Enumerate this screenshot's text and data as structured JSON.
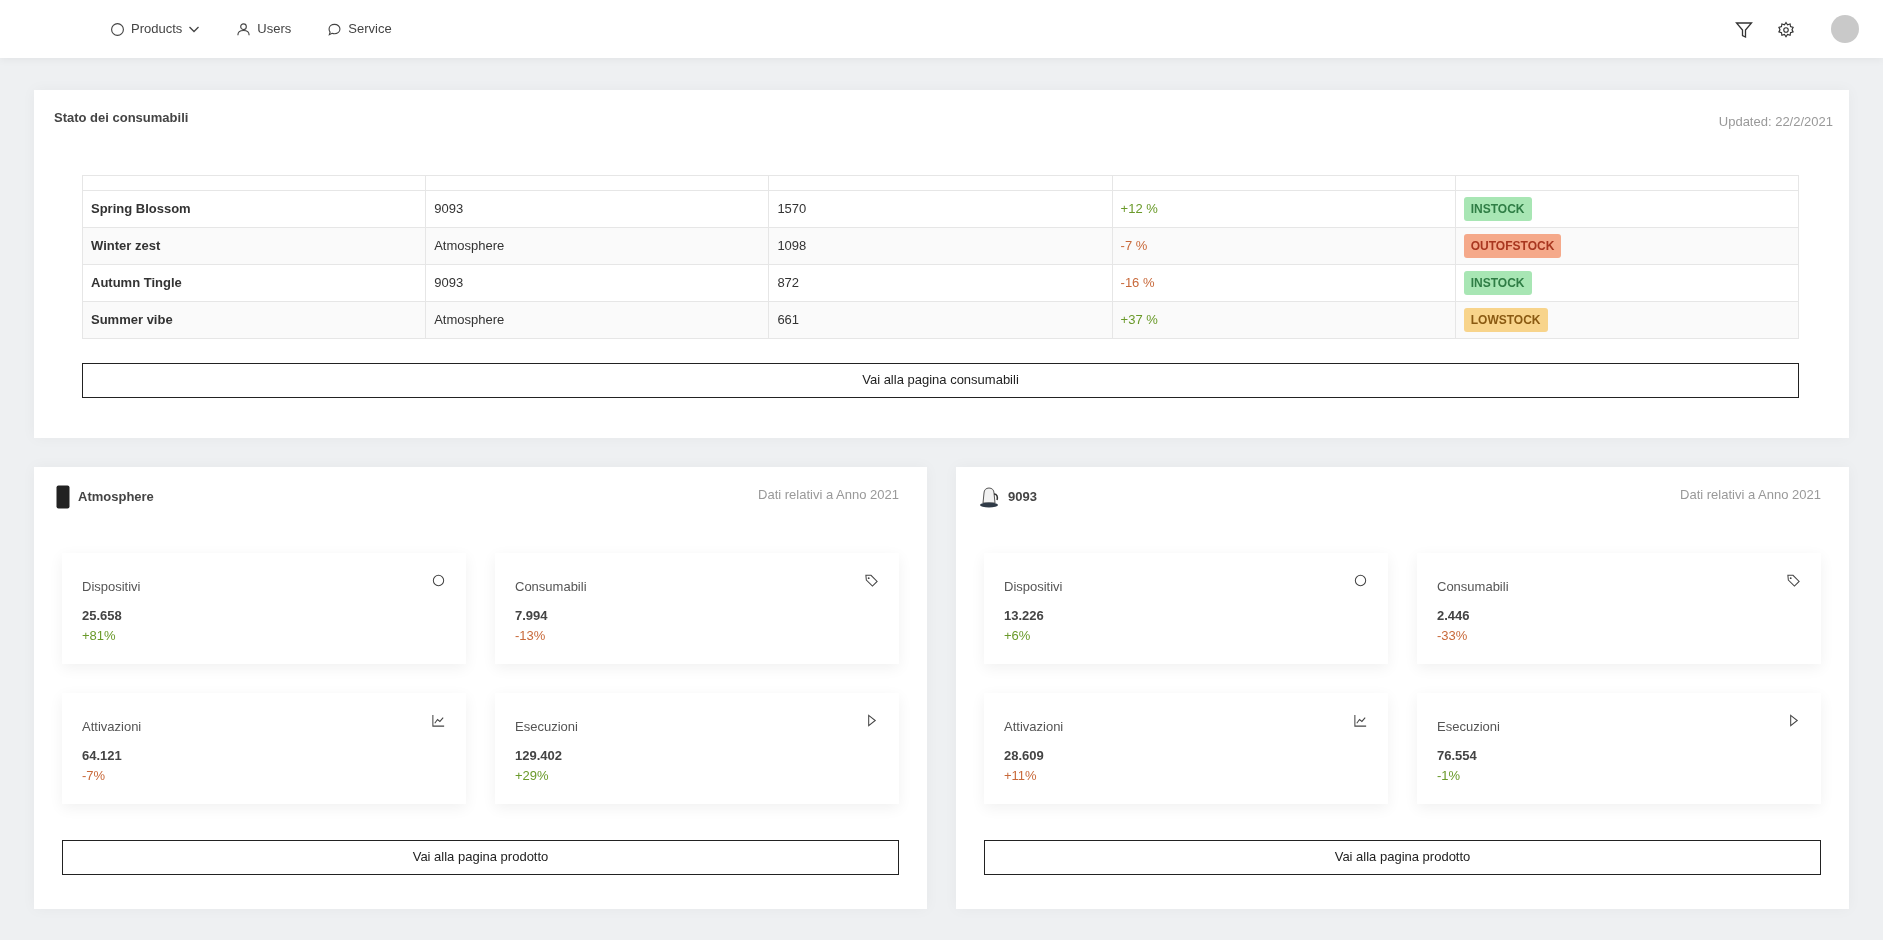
{
  "nav": {
    "items": [
      {
        "label": "Products",
        "kind": "products",
        "dropdown": true
      },
      {
        "label": "Users",
        "kind": "users",
        "dropdown": false
      },
      {
        "label": "Service",
        "kind": "service",
        "dropdown": false
      }
    ]
  },
  "consumables": {
    "title": "Stato dei consumabili",
    "updated": "Updated: 22/2/2021",
    "rows": [
      {
        "name": "Spring Blossom",
        "product": "9093",
        "count": "1570",
        "change": "+12 %",
        "color": "#6a9a2a",
        "status": "INSTOCK",
        "kind": "instock"
      },
      {
        "name": "Winter zest",
        "product": "Atmosphere",
        "count": "1098",
        "change": "-7 %",
        "color": "#c8693a",
        "status": "OUTOFSTOCK",
        "kind": "outofstock"
      },
      {
        "name": "Autumn Tingle",
        "product": "9093",
        "count": "872",
        "change": "-16 %",
        "color": "#c8693a",
        "status": "INSTOCK",
        "kind": "instock"
      },
      {
        "name": "Summer vibe",
        "product": "Atmosphere",
        "count": "661",
        "change": "+37 %",
        "color": "#6a9a2a",
        "status": "LOWSTOCK",
        "kind": "lowstock"
      }
    ],
    "button": "Vai alla pagina consumabili"
  },
  "products": [
    {
      "name": "Atmosphere",
      "kind": "tower",
      "period": "Dati relativi a Anno 2021",
      "button": "Vai alla pagina prodotto",
      "stats": [
        {
          "label": "Dispositivi",
          "kind": "devices",
          "value": "25.658",
          "change": "+81%",
          "color": "#6a9a2a"
        },
        {
          "label": "Consumabili",
          "kind": "consumables",
          "value": "7.994",
          "change": "-13%",
          "color": "#c8693a"
        },
        {
          "label": "Attivazioni",
          "kind": "activations",
          "value": "64.121",
          "change": "-7%",
          "color": "#c8693a"
        },
        {
          "label": "Esecuzioni",
          "kind": "executions",
          "value": "129.402",
          "change": "+29%",
          "color": "#6a9a2a"
        }
      ]
    },
    {
      "name": "9093",
      "kind": "kettle",
      "period": "Dati relativi a Anno 2021",
      "button": "Vai alla pagina prodotto",
      "stats": [
        {
          "label": "Dispositivi",
          "kind": "devices",
          "value": "13.226",
          "change": "+6%",
          "color": "#6a9a2a"
        },
        {
          "label": "Consumabili",
          "kind": "consumables",
          "value": "2.446",
          "change": "-33%",
          "color": "#c8693a"
        },
        {
          "label": "Attivazioni",
          "kind": "activations",
          "value": "28.609",
          "change": "+11%",
          "color": "#c8693a"
        },
        {
          "label": "Esecuzioni",
          "kind": "executions",
          "value": "76.554",
          "change": "-1%",
          "color": "#6a9a2a"
        }
      ]
    }
  ]
}
